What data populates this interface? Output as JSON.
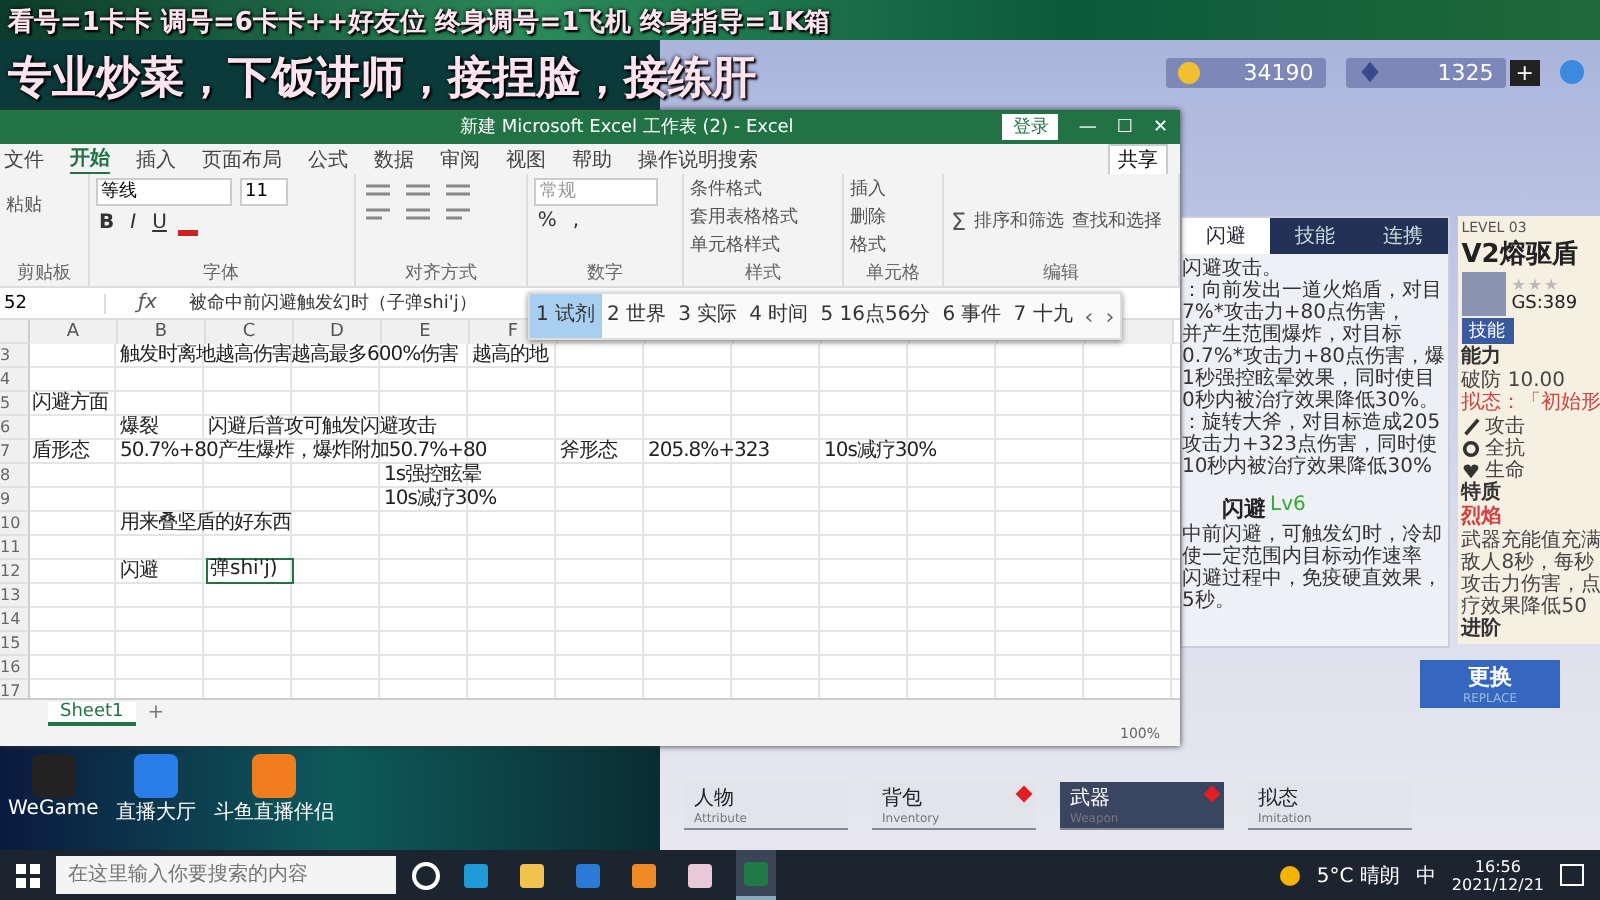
{
  "overlay": {
    "lines": [
      "看号=1卡卡 调号=6卡卡++好友位 终身调号=1飞机 终身指导=1K箱",
      "专业炒菜，下饭讲师，接捏脸，接练肝"
    ]
  },
  "excel": {
    "title": "新建 Microsoft Excel 工作表 (2) - Excel",
    "login": "登录",
    "window_controls": [
      "—",
      "☐",
      "✕"
    ],
    "fx": "ƒx",
    "add_sheet": "+",
    "menu": [
      {
        "label": "文件",
        "selected": false
      },
      {
        "label": "开始",
        "selected": true
      },
      {
        "label": "插入",
        "selected": false
      },
      {
        "label": "页面布局",
        "selected": false
      },
      {
        "label": "公式",
        "selected": false
      },
      {
        "label": "数据",
        "selected": false
      },
      {
        "label": "审阅",
        "selected": false
      },
      {
        "label": "视图",
        "selected": false
      },
      {
        "label": "帮助",
        "selected": false
      }
    ],
    "search": "操作说明搜索",
    "share": "共享",
    "ribbon": {
      "clipboard": {
        "paste": "粘贴",
        "label": "剪贴板"
      },
      "font": {
        "name": "等线",
        "size": "11",
        "styles": [
          "B",
          "I",
          "U"
        ],
        "label": "字体"
      },
      "alignment": {
        "label": "对齐方式"
      },
      "number": {
        "format": "常规",
        "symbols": [
          "%",
          ","
        ],
        "label": "数字"
      },
      "styles": {
        "items": [
          "条件格式",
          "套用表格格式",
          "单元格样式"
        ],
        "label": "样式"
      },
      "cells": {
        "items": [
          "插入",
          "删除",
          "格式"
        ],
        "label": "单元格"
      },
      "editing": {
        "sum": "Σ",
        "items": [
          "排序和筛选",
          "查找和选择"
        ],
        "label": "编辑"
      }
    },
    "name_box": "52",
    "formula": "被命中前闪避触发幻时（子弹shi'j）",
    "columns": [
      "A",
      "B",
      "C",
      "D",
      "E",
      "F"
    ],
    "rows": [
      {
        "number": "3",
        "cells": [
          null,
          "触发时离地越高伤害越高最多600%伤害",
          null,
          null,
          null,
          "越高的地"
        ]
      },
      {
        "number": "4"
      },
      {
        "number": "5",
        "cells": [
          "闪避方面"
        ]
      },
      {
        "number": "6",
        "cells": [
          null,
          "爆裂",
          "闪避后普攻可触发闪避攻击"
        ]
      },
      {
        "number": "7",
        "cells": [
          "盾形态",
          "50.7%+80产生爆炸，爆炸附加50.7%+80",
          null,
          null,
          null,
          null,
          "斧形态",
          "205.8%+323",
          null,
          "10s减疗30%"
        ]
      },
      {
        "number": "8",
        "cells": [
          null,
          null,
          null,
          null,
          "1s强控眩晕"
        ]
      },
      {
        "number": "9",
        "cells": [
          null,
          null,
          null,
          null,
          "10s减疗30%"
        ]
      },
      {
        "number": "10",
        "cells": [
          null,
          "用来叠坚盾的好东西"
        ]
      },
      {
        "number": "11"
      },
      {
        "number": "12",
        "cells": [
          null,
          "闪避",
          {
            "text": "弹shi'j)",
            "selected": true
          }
        ]
      },
      {
        "number": "13"
      },
      {
        "number": "14"
      },
      {
        "number": "15"
      },
      {
        "number": "16"
      },
      {
        "number": "17"
      }
    ],
    "sheets": [
      {
        "label": "Sheet1",
        "selected": true
      }
    ],
    "zoom": "100%"
  },
  "ime": {
    "candidates": [
      {
        "label": "1 试剂",
        "selected": true
      },
      {
        "label": "2 世界",
        "selected": false
      },
      {
        "label": "3 实际",
        "selected": false
      },
      {
        "label": "4 时间",
        "selected": false
      },
      {
        "label": "5 16点56分",
        "selected": false
      },
      {
        "label": "6 事件",
        "selected": false
      },
      {
        "label": "7 十九",
        "selected": false
      }
    ],
    "prev": "‹",
    "next": "›"
  },
  "game": {
    "add": "+",
    "currencies": [
      {
        "kind": "coin",
        "value": "34190"
      },
      {
        "kind": "crystal",
        "value": "1325"
      }
    ],
    "tabs": [
      {
        "label": "闪避",
        "selected": true
      },
      {
        "label": "技能",
        "selected": false
      },
      {
        "label": "连携",
        "selected": false
      }
    ],
    "description": [
      "闪避攻击。",
      "：向前发出一道火焰盾，对目",
      "7%*攻击力+80点伤害，",
      "并产生范围爆炸，对目标",
      "0.7%*攻击力+80点伤害，爆",
      "1秒强控眩晕效果，同时使目",
      "0秒内被治疗效果降低30%。",
      "：旋转大斧，对目标造成205",
      "攻击力+323点伤害，同时使",
      "10秒内被治疗效果降低30%"
    ],
    "skill": {
      "name": "闪避",
      "level": "Lv6",
      "text": [
        "中前闪避，可触发幻时，冷却",
        "使一定范围内目标动作速率",
        "闪避过程中，免疫硬直效果，",
        "5秒。"
      ]
    },
    "weapon": {
      "level_tag": "LEVEL 03",
      "name": "V2熔驱盾",
      "stars": 3,
      "gs": "GS:389",
      "skill_button": "技能",
      "ability": "能力",
      "break": "破防 10.00",
      "form": "拟态：「初始形",
      "stats": [
        {
          "kind": "attack",
          "label": "攻击"
        },
        {
          "kind": "resist",
          "label": "全抗"
        },
        {
          "kind": "health",
          "label": "生命"
        }
      ],
      "trait": "特质",
      "trait_name": "烈焰",
      "trait_text": [
        "武器充能值充满",
        "敌人8秒，每秒",
        "攻击力伤害，点",
        "疗效果降低50"
      ],
      "advance": "进阶"
    },
    "replace": {
      "label": "更换",
      "sub": "REPLACE"
    },
    "nav": [
      {
        "label": "人物",
        "sub": "Attribute",
        "selected": false,
        "alert": false
      },
      {
        "label": "背包",
        "sub": "Inventory",
        "selected": false,
        "alert": true
      },
      {
        "label": "武器",
        "sub": "Weapon",
        "selected": true,
        "alert": true
      },
      {
        "label": "拟态",
        "sub": "Imitation",
        "selected": false,
        "alert": false
      }
    ]
  },
  "desktop": {
    "icons": [
      {
        "kind": "wegame",
        "label": "WeGame"
      },
      {
        "kind": "live",
        "label": "直播大厅"
      },
      {
        "kind": "douyu",
        "label": "斗鱼直播伴侣"
      }
    ]
  },
  "taskbar": {
    "search_placeholder": "在这里输入你要搜索的内容",
    "apps": [
      {
        "kind": "edge",
        "active": false
      },
      {
        "kind": "folder",
        "active": false
      },
      {
        "kind": "mail",
        "active": false
      },
      {
        "kind": "game",
        "active": false
      },
      {
        "kind": "anime",
        "active": false
      },
      {
        "kind": "excel",
        "active": true
      }
    ],
    "weather": "5°C 晴朗",
    "ime": "中",
    "time": "16:56",
    "date": "2021/12/21"
  }
}
